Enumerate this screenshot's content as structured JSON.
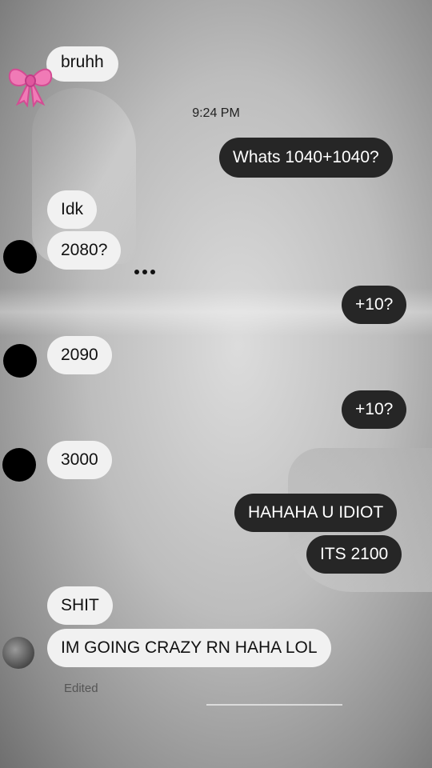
{
  "chat": {
    "timestamp": "9:24 PM",
    "partial_top": "bruhh",
    "edited_label": "Edited",
    "messages": [
      {
        "id": "m1",
        "sender": "me",
        "text": "Whats 1040+1040?"
      },
      {
        "id": "m2",
        "sender": "them",
        "text": "Idk"
      },
      {
        "id": "m3",
        "sender": "them",
        "text": "2080?"
      },
      {
        "id": "m4",
        "sender": "me",
        "text": "+10?"
      },
      {
        "id": "m5",
        "sender": "them",
        "text": "2090"
      },
      {
        "id": "m6",
        "sender": "me",
        "text": "+10?"
      },
      {
        "id": "m7",
        "sender": "them",
        "text": "3000"
      },
      {
        "id": "m8",
        "sender": "me",
        "text": "HAHAHA U IDIOT"
      },
      {
        "id": "m9",
        "sender": "me",
        "text": "ITS 2100"
      },
      {
        "id": "m10",
        "sender": "them",
        "text": "SHIT"
      },
      {
        "id": "m11",
        "sender": "them",
        "text": "IM GOING CRAZY RN HAHA LOL"
      }
    ]
  },
  "theme": {
    "incoming_bubble": "#f1f1f1",
    "outgoing_bubble": "#262626",
    "bow_color": "#f06fb0"
  },
  "icons": {
    "bow": "pink-bow-icon",
    "typing": "typing-indicator-icon"
  }
}
